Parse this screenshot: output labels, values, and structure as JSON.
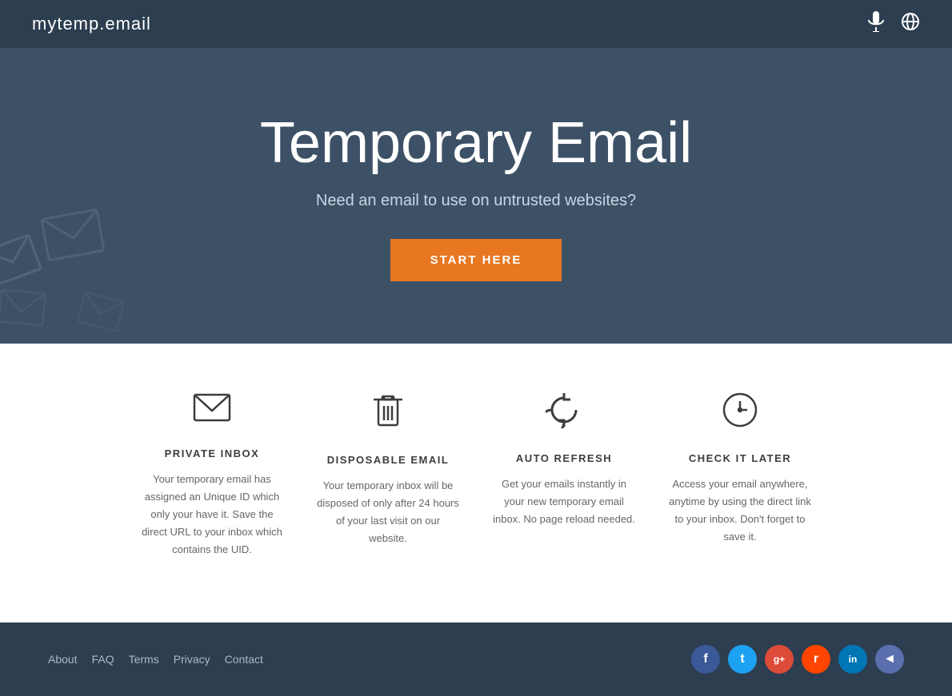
{
  "header": {
    "logo": "mytemp.email",
    "mic_icon": "🎤",
    "globe_icon": "🌐"
  },
  "hero": {
    "title": "Temporary Email",
    "subtitle": "Need an email to use on untrusted websites?",
    "cta_button": "START HERE"
  },
  "features": [
    {
      "id": "private-inbox",
      "icon": "envelope",
      "title": "PRIVATE INBOX",
      "description": "Your temporary email has assigned an Unique ID which only your have it. Save the direct URL to your inbox which contains the UID."
    },
    {
      "id": "disposable-email",
      "icon": "trash",
      "title": "DISPOSABLE EMAIL",
      "description": "Your temporary inbox will be disposed of only after 24 hours of your last visit on our website."
    },
    {
      "id": "auto-refresh",
      "icon": "refresh",
      "title": "AUTO REFRESH",
      "description": "Get your emails instantly in your new temporary email inbox. No page reload needed."
    },
    {
      "id": "check-it-later",
      "icon": "clock",
      "title": "CHECK IT LATER",
      "description": "Access your email anywhere, anytime by using the direct link to your inbox. Don't forget to save it."
    }
  ],
  "footer": {
    "links": [
      {
        "label": "About",
        "href": "#"
      },
      {
        "label": "FAQ",
        "href": "#"
      },
      {
        "label": "Terms",
        "href": "#"
      },
      {
        "label": "Privacy",
        "href": "#"
      },
      {
        "label": "Contact",
        "href": "#"
      }
    ],
    "social": [
      {
        "name": "facebook",
        "label": "f",
        "class": "social-fb"
      },
      {
        "name": "twitter",
        "label": "t",
        "class": "social-tw"
      },
      {
        "name": "google-plus",
        "label": "g+",
        "class": "social-gp"
      },
      {
        "name": "reddit",
        "label": "r",
        "class": "social-rd"
      },
      {
        "name": "linkedin",
        "label": "in",
        "class": "social-li"
      },
      {
        "name": "misc",
        "label": "◄",
        "class": "social-misc"
      }
    ]
  }
}
